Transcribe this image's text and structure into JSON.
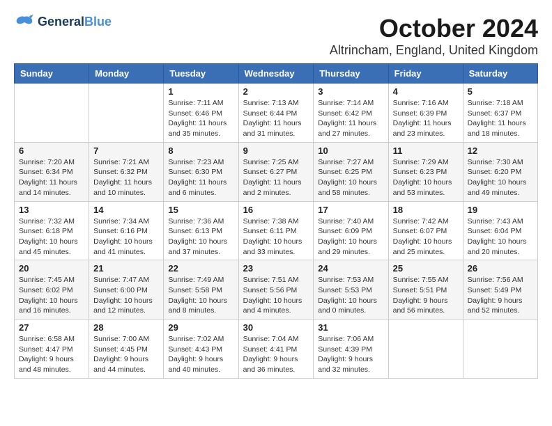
{
  "logo": {
    "line1": "General",
    "line2": "Blue"
  },
  "title": "October 2024",
  "location": "Altrincham, England, United Kingdom",
  "days_of_week": [
    "Sunday",
    "Monday",
    "Tuesday",
    "Wednesday",
    "Thursday",
    "Friday",
    "Saturday"
  ],
  "weeks": [
    [
      {
        "day": "",
        "info": ""
      },
      {
        "day": "",
        "info": ""
      },
      {
        "day": "1",
        "info": "Sunrise: 7:11 AM\nSunset: 6:46 PM\nDaylight: 11 hours and 35 minutes."
      },
      {
        "day": "2",
        "info": "Sunrise: 7:13 AM\nSunset: 6:44 PM\nDaylight: 11 hours and 31 minutes."
      },
      {
        "day": "3",
        "info": "Sunrise: 7:14 AM\nSunset: 6:42 PM\nDaylight: 11 hours and 27 minutes."
      },
      {
        "day": "4",
        "info": "Sunrise: 7:16 AM\nSunset: 6:39 PM\nDaylight: 11 hours and 23 minutes."
      },
      {
        "day": "5",
        "info": "Sunrise: 7:18 AM\nSunset: 6:37 PM\nDaylight: 11 hours and 18 minutes."
      }
    ],
    [
      {
        "day": "6",
        "info": "Sunrise: 7:20 AM\nSunset: 6:34 PM\nDaylight: 11 hours and 14 minutes."
      },
      {
        "day": "7",
        "info": "Sunrise: 7:21 AM\nSunset: 6:32 PM\nDaylight: 11 hours and 10 minutes."
      },
      {
        "day": "8",
        "info": "Sunrise: 7:23 AM\nSunset: 6:30 PM\nDaylight: 11 hours and 6 minutes."
      },
      {
        "day": "9",
        "info": "Sunrise: 7:25 AM\nSunset: 6:27 PM\nDaylight: 11 hours and 2 minutes."
      },
      {
        "day": "10",
        "info": "Sunrise: 7:27 AM\nSunset: 6:25 PM\nDaylight: 10 hours and 58 minutes."
      },
      {
        "day": "11",
        "info": "Sunrise: 7:29 AM\nSunset: 6:23 PM\nDaylight: 10 hours and 53 minutes."
      },
      {
        "day": "12",
        "info": "Sunrise: 7:30 AM\nSunset: 6:20 PM\nDaylight: 10 hours and 49 minutes."
      }
    ],
    [
      {
        "day": "13",
        "info": "Sunrise: 7:32 AM\nSunset: 6:18 PM\nDaylight: 10 hours and 45 minutes."
      },
      {
        "day": "14",
        "info": "Sunrise: 7:34 AM\nSunset: 6:16 PM\nDaylight: 10 hours and 41 minutes."
      },
      {
        "day": "15",
        "info": "Sunrise: 7:36 AM\nSunset: 6:13 PM\nDaylight: 10 hours and 37 minutes."
      },
      {
        "day": "16",
        "info": "Sunrise: 7:38 AM\nSunset: 6:11 PM\nDaylight: 10 hours and 33 minutes."
      },
      {
        "day": "17",
        "info": "Sunrise: 7:40 AM\nSunset: 6:09 PM\nDaylight: 10 hours and 29 minutes."
      },
      {
        "day": "18",
        "info": "Sunrise: 7:42 AM\nSunset: 6:07 PM\nDaylight: 10 hours and 25 minutes."
      },
      {
        "day": "19",
        "info": "Sunrise: 7:43 AM\nSunset: 6:04 PM\nDaylight: 10 hours and 20 minutes."
      }
    ],
    [
      {
        "day": "20",
        "info": "Sunrise: 7:45 AM\nSunset: 6:02 PM\nDaylight: 10 hours and 16 minutes."
      },
      {
        "day": "21",
        "info": "Sunrise: 7:47 AM\nSunset: 6:00 PM\nDaylight: 10 hours and 12 minutes."
      },
      {
        "day": "22",
        "info": "Sunrise: 7:49 AM\nSunset: 5:58 PM\nDaylight: 10 hours and 8 minutes."
      },
      {
        "day": "23",
        "info": "Sunrise: 7:51 AM\nSunset: 5:56 PM\nDaylight: 10 hours and 4 minutes."
      },
      {
        "day": "24",
        "info": "Sunrise: 7:53 AM\nSunset: 5:53 PM\nDaylight: 10 hours and 0 minutes."
      },
      {
        "day": "25",
        "info": "Sunrise: 7:55 AM\nSunset: 5:51 PM\nDaylight: 9 hours and 56 minutes."
      },
      {
        "day": "26",
        "info": "Sunrise: 7:56 AM\nSunset: 5:49 PM\nDaylight: 9 hours and 52 minutes."
      }
    ],
    [
      {
        "day": "27",
        "info": "Sunrise: 6:58 AM\nSunset: 4:47 PM\nDaylight: 9 hours and 48 minutes."
      },
      {
        "day": "28",
        "info": "Sunrise: 7:00 AM\nSunset: 4:45 PM\nDaylight: 9 hours and 44 minutes."
      },
      {
        "day": "29",
        "info": "Sunrise: 7:02 AM\nSunset: 4:43 PM\nDaylight: 9 hours and 40 minutes."
      },
      {
        "day": "30",
        "info": "Sunrise: 7:04 AM\nSunset: 4:41 PM\nDaylight: 9 hours and 36 minutes."
      },
      {
        "day": "31",
        "info": "Sunrise: 7:06 AM\nSunset: 4:39 PM\nDaylight: 9 hours and 32 minutes."
      },
      {
        "day": "",
        "info": ""
      },
      {
        "day": "",
        "info": ""
      }
    ]
  ]
}
